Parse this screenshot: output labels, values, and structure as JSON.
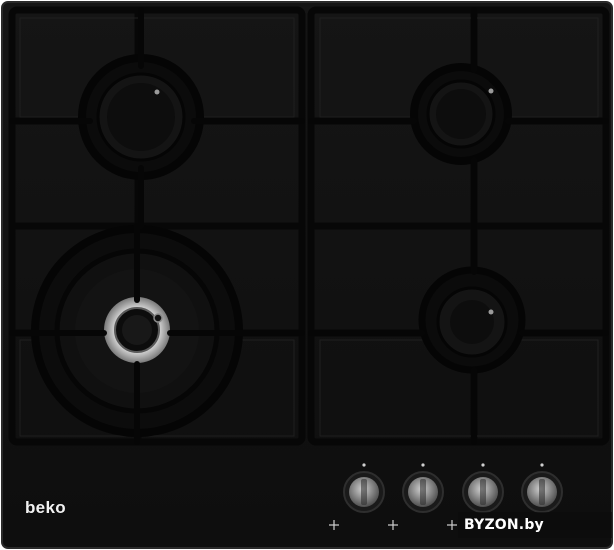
{
  "product": {
    "brand_logo_text": "beko",
    "watermark_text": "BYZON.by",
    "burners": [
      {
        "id": "rear-left",
        "type": "standard"
      },
      {
        "id": "rear-right",
        "type": "standard"
      },
      {
        "id": "front-left",
        "type": "wok"
      },
      {
        "id": "front-right",
        "type": "auxiliary"
      }
    ],
    "knobs_count": 4,
    "colors": {
      "glass": "#121212",
      "grate": "#0a0a0a",
      "knob_metal": "#9a9a9a",
      "wok_ring": "#c8c8c8",
      "watermark_accent": "#5b8fd6"
    }
  }
}
